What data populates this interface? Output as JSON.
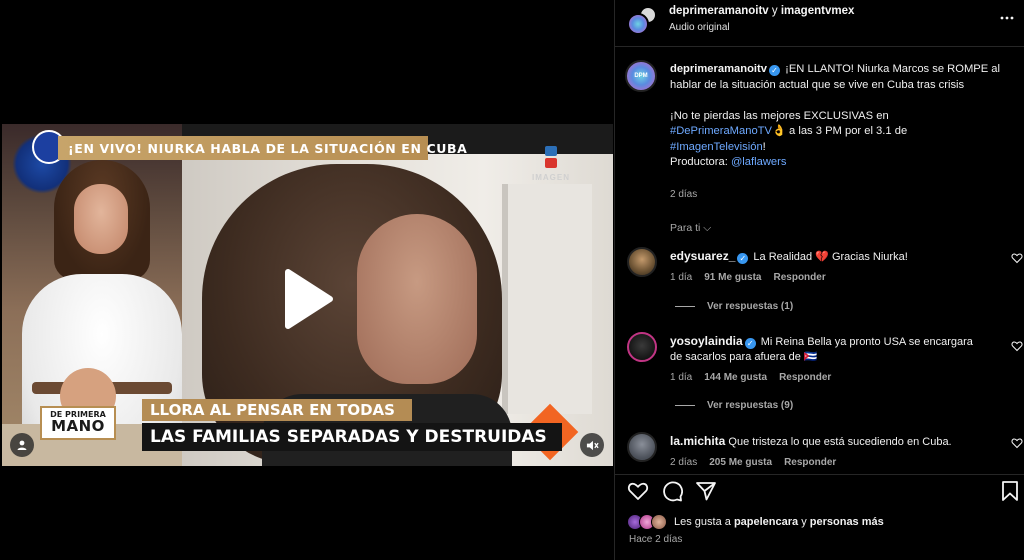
{
  "video": {
    "banner_top": "¡EN VIVO! NIURKA HABLA DE LA SITUACIÓN EN CUBA",
    "imagen_logo_text": "IMAGEN",
    "lower_third_line1": "LLORA AL PENSAR EN TODAS",
    "lower_third_line2": "LAS FAMILIAS SEPARADAS Y DESTRUIDAS",
    "show_logo_line1": "DE PRIMERA",
    "show_logo_line2": "MANO",
    "play_icon": "play-icon",
    "mute_icon": "muted-speaker-icon",
    "user_tag_icon": "user-tag-icon"
  },
  "header": {
    "account1": "deprimeramanoitv",
    "separator": "y",
    "account2": "imagentvmex",
    "audio": "Audio original",
    "more_icon": "more-options-icon"
  },
  "caption": {
    "avatar_text": "DPM",
    "username": "deprimeramanoitv",
    "text_part1": " ¡EN LLANTO! Niurka Marcos se ROMPE al hablar de la situación actual que se vive en Cuba tras crisis",
    "text_part2": "¡No te pierdas las mejores EXCLUSIVAS en ",
    "hashtag1": "#DePrimeraManoTV",
    "text_part3": "👌 a las 3 PM por el 3.1 de ",
    "hashtag2": "#ImagenTelevisión",
    "text_part4": "!",
    "producer_label": "Productora: ",
    "producer_handle": "@laflawers",
    "time": "2 días"
  },
  "comments_filter": "Para ti ⌵",
  "comments": [
    {
      "username": "edysuarez_",
      "text": " La Realidad 💔 Gracias Niurka!",
      "time": "1 día",
      "likes": "91 Me gusta",
      "reply": "Responder",
      "view_replies": "Ver respuestas (1)"
    },
    {
      "username": "yosoylaindia",
      "text": " Mi Reina Bella ya pronto USA se encargara de sacarlos para afuera de 🇨🇺",
      "time": "1 día",
      "likes": "144 Me gusta",
      "reply": "Responder",
      "view_replies": "Ver respuestas (9)"
    },
    {
      "username": "la.michita",
      "text": " Que tristeza lo que está sucediendo en Cuba.",
      "time": "2 días",
      "likes": "205 Me gusta",
      "reply": "Responder"
    }
  ],
  "actions": {
    "like_icon": "heart-icon",
    "comment_icon": "comment-icon",
    "share_icon": "share-icon",
    "save_icon": "bookmark-icon"
  },
  "likes": {
    "prefix": "Les gusta a ",
    "user": "papelencara",
    "connector": " y ",
    "others": "personas más"
  },
  "post_time": "Hace 2 días",
  "colors": {
    "background": "#000000",
    "link": "#6ea9ff",
    "verified": "#3897f0",
    "muted_text": "#a8a8a8",
    "banner_gold": "#b78e52"
  }
}
